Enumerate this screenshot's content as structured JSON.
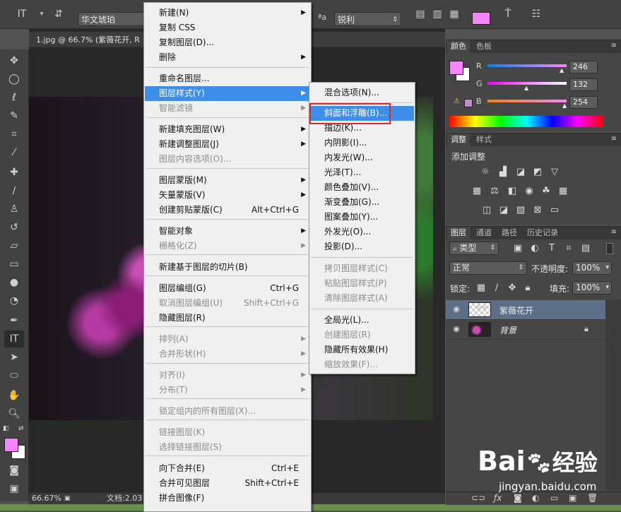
{
  "colors": {
    "accent_highlight": "#3d8ee8",
    "foreground_swatch": "#f684fe",
    "selection_box": "#e02828",
    "layer_selected": "#5d6f87"
  },
  "options_bar": {
    "font_family": "华文琥珀",
    "antialias": "锐利",
    "aa_label": "a"
  },
  "document": {
    "tab_title": "1.jpg @ 66.7% (紫薇花开, R"
  },
  "status_bar": {
    "zoom": "66.67%",
    "doc_info": "文档:2.03"
  },
  "context_menu": {
    "items": [
      {
        "label": "新建(N)",
        "shortcut": "",
        "submenu": true,
        "disabled": false
      },
      {
        "label": "复制 CSS",
        "shortcut": "",
        "submenu": false,
        "disabled": false
      },
      {
        "label": "复制图层(D)...",
        "shortcut": "",
        "submenu": false,
        "disabled": false
      },
      {
        "label": "删除",
        "shortcut": "",
        "submenu": true,
        "disabled": false
      },
      {
        "label": "重命名图层...",
        "shortcut": "",
        "submenu": false,
        "disabled": false
      },
      {
        "label": "图层样式(Y)",
        "shortcut": "",
        "submenu": true,
        "disabled": false,
        "highlighted": true
      },
      {
        "label": "智能滤镜",
        "shortcut": "",
        "submenu": true,
        "disabled": true
      },
      {
        "label": "新建填充图层(W)",
        "shortcut": "",
        "submenu": true,
        "disabled": false
      },
      {
        "label": "新建调整图层(J)",
        "shortcut": "",
        "submenu": true,
        "disabled": false
      },
      {
        "label": "图层内容选项(O)...",
        "shortcut": "",
        "submenu": false,
        "disabled": true
      },
      {
        "label": "图层蒙版(M)",
        "shortcut": "",
        "submenu": true,
        "disabled": false
      },
      {
        "label": "矢量蒙版(V)",
        "shortcut": "",
        "submenu": true,
        "disabled": false
      },
      {
        "label": "创建剪贴蒙版(C)",
        "shortcut": "Alt+Ctrl+G",
        "submenu": false,
        "disabled": false
      },
      {
        "label": "智能对象",
        "shortcut": "",
        "submenu": true,
        "disabled": false
      },
      {
        "label": "栅格化(Z)",
        "shortcut": "",
        "submenu": true,
        "disabled": true
      },
      {
        "label": "新建基于图层的切片(B)",
        "shortcut": "",
        "submenu": false,
        "disabled": false
      },
      {
        "label": "图层编组(G)",
        "shortcut": "Ctrl+G",
        "submenu": false,
        "disabled": false
      },
      {
        "label": "取消图层编组(U)",
        "shortcut": "Shift+Ctrl+G",
        "submenu": false,
        "disabled": true
      },
      {
        "label": "隐藏图层(R)",
        "shortcut": "",
        "submenu": false,
        "disabled": false
      },
      {
        "label": "排列(A)",
        "shortcut": "",
        "submenu": true,
        "disabled": true
      },
      {
        "label": "合并形状(H)",
        "shortcut": "",
        "submenu": true,
        "disabled": true
      },
      {
        "label": "对齐(I)",
        "shortcut": "",
        "submenu": true,
        "disabled": true
      },
      {
        "label": "分布(T)",
        "shortcut": "",
        "submenu": true,
        "disabled": true
      },
      {
        "label": "锁定组内的所有图层(X)...",
        "shortcut": "",
        "submenu": false,
        "disabled": true
      },
      {
        "label": "链接图层(K)",
        "shortcut": "",
        "submenu": false,
        "disabled": true
      },
      {
        "label": "选择链接图层(S)",
        "shortcut": "",
        "submenu": false,
        "disabled": true
      },
      {
        "label": "向下合并(E)",
        "shortcut": "Ctrl+E",
        "submenu": false,
        "disabled": false
      },
      {
        "label": "合并可见图层",
        "shortcut": "Shift+Ctrl+E",
        "submenu": false,
        "disabled": false
      },
      {
        "label": "拼合图像(F)",
        "shortcut": "",
        "submenu": false,
        "disabled": false
      }
    ]
  },
  "layer_style_submenu": {
    "items": [
      {
        "label": "混合选项(N)...",
        "disabled": false
      },
      {
        "label": "斜面和浮雕(B)...",
        "disabled": false,
        "highlighted": true
      },
      {
        "label": "描边(K)...",
        "disabled": false
      },
      {
        "label": "内阴影(I)...",
        "disabled": false
      },
      {
        "label": "内发光(W)...",
        "disabled": false
      },
      {
        "label": "光泽(T)...",
        "disabled": false
      },
      {
        "label": "颜色叠加(V)...",
        "disabled": false
      },
      {
        "label": "渐变叠加(G)...",
        "disabled": false
      },
      {
        "label": "图案叠加(Y)...",
        "disabled": false
      },
      {
        "label": "外发光(O)...",
        "disabled": false
      },
      {
        "label": "投影(D)...",
        "disabled": false
      },
      {
        "label": "拷贝图层样式(C)",
        "disabled": true
      },
      {
        "label": "粘贴图层样式(P)",
        "disabled": true
      },
      {
        "label": "清除图层样式(A)",
        "disabled": true
      },
      {
        "label": "全局光(L)...",
        "disabled": false
      },
      {
        "label": "创建图层(R)",
        "disabled": true
      },
      {
        "label": "隐藏所有效果(H)",
        "disabled": false
      },
      {
        "label": "缩放效果(F)...",
        "disabled": true
      }
    ]
  },
  "color_panel": {
    "tabs": [
      "颜色",
      "色板"
    ],
    "channels": [
      {
        "label": "R",
        "value": "246"
      },
      {
        "label": "G",
        "value": "132"
      },
      {
        "label": "B",
        "value": "254"
      }
    ]
  },
  "adjustments_panel": {
    "tabs": [
      "调整",
      "样式"
    ],
    "heading": "添加调整"
  },
  "layers_panel": {
    "tabs": [
      "图层",
      "通道",
      "路径",
      "历史记录"
    ],
    "filter_kind": "类型",
    "blend_mode": "正常",
    "opacity_label": "不透明度:",
    "opacity_value": "100%",
    "lock_label": "锁定:",
    "fill_label": "填充:",
    "fill_value": "100%",
    "layers": [
      {
        "name": "紫薇花开",
        "selected": true
      },
      {
        "name": "背景",
        "selected": false
      }
    ]
  },
  "watermark": {
    "brand": "Bai",
    "brand_suffix": "经验",
    "url": "jingyan.baidu.com"
  }
}
